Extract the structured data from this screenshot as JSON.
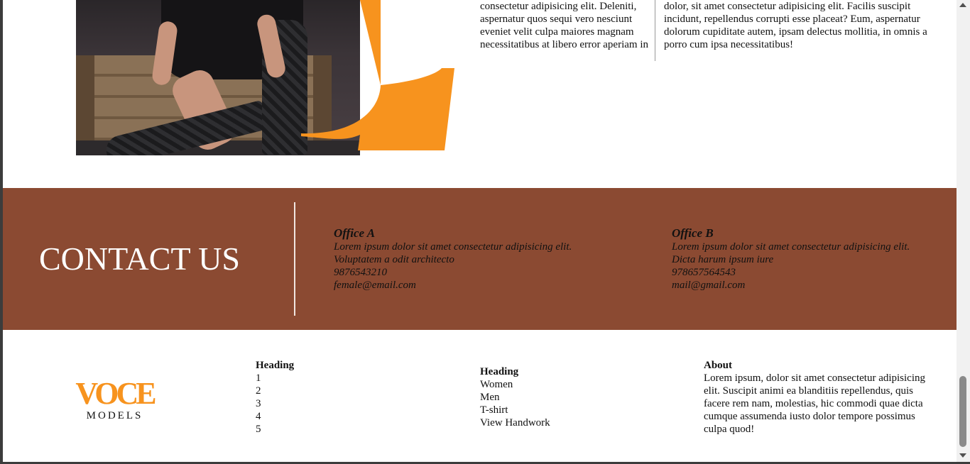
{
  "top": {
    "col1_text": "consectetur adipisicing elit. Deleniti, aspernatur quos sequi vero nesciunt eveniet velit culpa maiores magnam necessitatibus at libero error aperiam in",
    "col2_text": "dolor, sit amet consectetur adipisicing elit. Facilis suscipit incidunt, repellendus corrupti esse placeat? Eum, aspernatur dolorum cupiditate autem, ipsam delectus mollitia, in omnis a porro cum ipsa necessitatibus!",
    "accent_color": "#f7931e"
  },
  "contact": {
    "title": "CONTACT US",
    "background": "#8b4a32",
    "office_a": {
      "heading": "Office A",
      "address": "Lorem ipsum dolor sit amet consectetur adipisicing elit. Voluptatem a odit architecto",
      "phone": "9876543210",
      "email": "female@email.com"
    },
    "office_b": {
      "heading": "Office B",
      "address": "Lorem ipsum dolor sit amet consectetur adipisicing elit. Dicta harum ipsum iure",
      "phone": "978657564543",
      "email": "mail@gmail.com"
    }
  },
  "footer": {
    "logo": {
      "word": "VOCE",
      "sub": "MODELS",
      "color": "#f7931e"
    },
    "col1": {
      "heading": "Heading",
      "items": [
        "1",
        "2",
        "3",
        "4",
        "5"
      ]
    },
    "col2": {
      "heading": "Heading",
      "items": [
        "Women",
        "Men",
        "T-shirt",
        "View Handwork"
      ]
    },
    "about": {
      "heading": "About",
      "text": "Lorem ipsum, dolor sit amet consectetur adipisicing elit. Suscipit animi ea blanditiis repellendus, quis facere rem nam, molestias, hic commodi quae dicta cumque assumenda iusto dolor tempore possimus culpa quod!"
    }
  }
}
